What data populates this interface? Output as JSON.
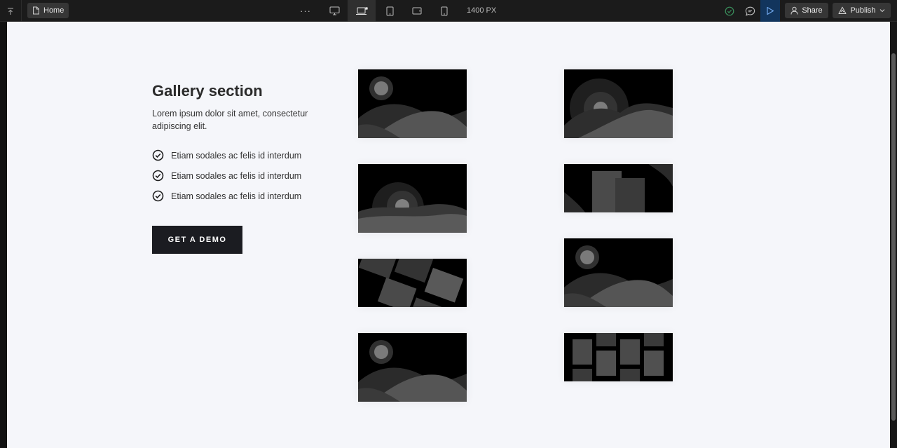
{
  "toolbar": {
    "page_name": "Home",
    "more_label": "···",
    "breakpoint_width": "1400 PX",
    "share_label": "Share",
    "publish_label": "Publish",
    "breakpoints": [
      "desktop",
      "laptop-custom",
      "tablet",
      "tablet-landscape",
      "mobile"
    ],
    "active_breakpoint": "laptop-custom"
  },
  "gallery": {
    "title": "Gallery section",
    "description": "Lorem ipsum dolor sit amet, consectetur adipiscing elit.",
    "features": [
      "Etiam sodales ac felis id interdum",
      "Etiam sodales ac felis id interdum",
      "Etiam sodales ac felis id interdum"
    ],
    "cta_label": "GET A DEMO"
  },
  "colors": {
    "toolbar_bg": "#1b1b1b",
    "canvas_bg": "#f5f6fa",
    "cta_bg": "#1b1c21",
    "play_bg": "#12355d",
    "check_green": "#3a8f5c"
  }
}
